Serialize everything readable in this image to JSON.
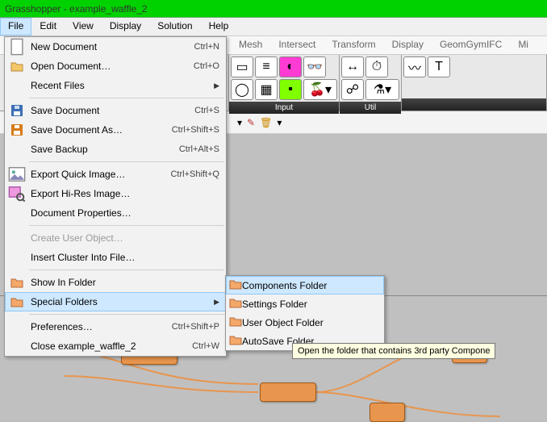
{
  "title": "Grasshopper - example_waffle_2",
  "menubar": [
    "File",
    "Edit",
    "View",
    "Display",
    "Solution",
    "Help"
  ],
  "ribbon_tabs": [
    "Mesh",
    "Intersect",
    "Transform",
    "Display",
    "GeomGymIFC",
    "Mi"
  ],
  "ribbon_groups": {
    "g1": "Input",
    "g2": "Util"
  },
  "file_menu": {
    "new": {
      "label": "New Document",
      "shortcut": "Ctrl+N"
    },
    "open": {
      "label": "Open Document…",
      "shortcut": "Ctrl+O"
    },
    "recent": {
      "label": "Recent Files"
    },
    "save": {
      "label": "Save Document",
      "shortcut": "Ctrl+S"
    },
    "saveas": {
      "label": "Save Document As…",
      "shortcut": "Ctrl+Shift+S"
    },
    "backup": {
      "label": "Save Backup",
      "shortcut": "Ctrl+Alt+S"
    },
    "exportq": {
      "label": "Export Quick Image…",
      "shortcut": "Ctrl+Shift+Q"
    },
    "exporth": {
      "label": "Export Hi-Res Image…"
    },
    "props": {
      "label": "Document Properties…"
    },
    "createuo": {
      "label": "Create User Object…"
    },
    "cluster": {
      "label": "Insert Cluster Into File…"
    },
    "showfolder": {
      "label": "Show In Folder"
    },
    "special": {
      "label": "Special Folders"
    },
    "prefs": {
      "label": "Preferences…",
      "shortcut": "Ctrl+Shift+P"
    },
    "close": {
      "label": "Close example_waffle_2",
      "shortcut": "Ctrl+W"
    }
  },
  "submenu": {
    "components": "Components Folder",
    "settings": "Settings Folder",
    "userobj": "User Object Folder",
    "autosave": "AutoSave Folder"
  },
  "tooltip": "Open the folder that contains 3rd party Compone"
}
